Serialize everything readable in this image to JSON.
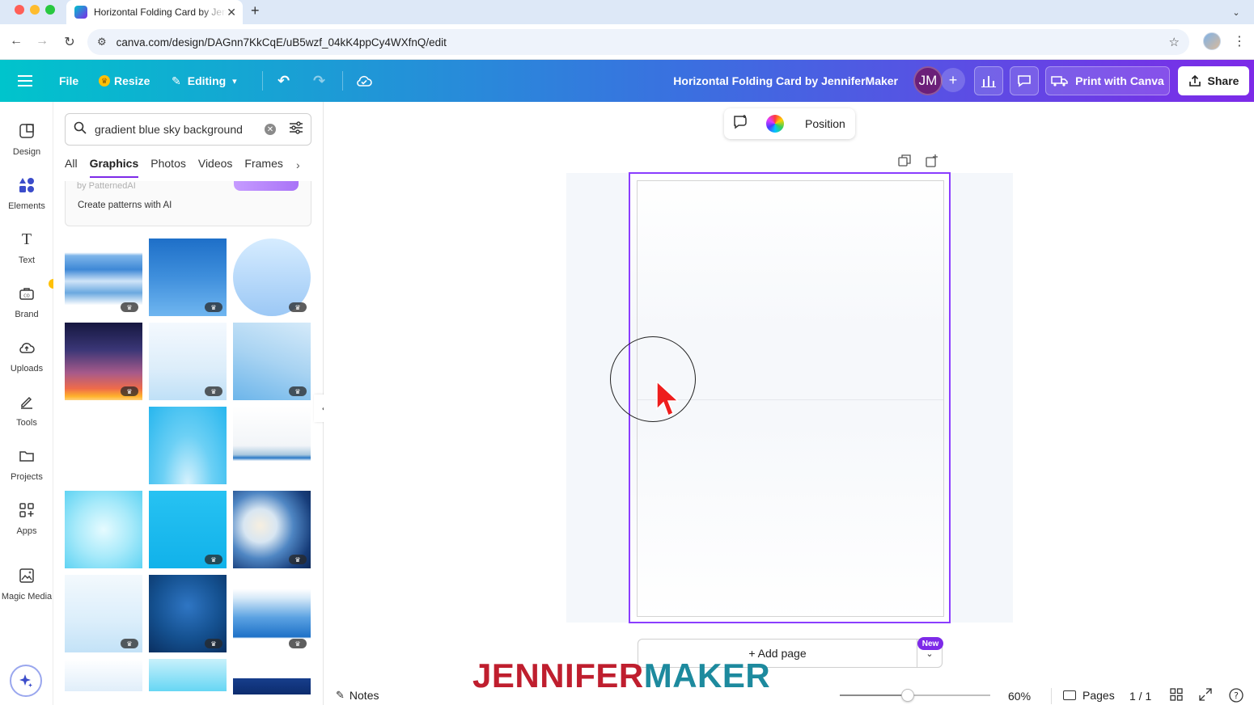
{
  "browser": {
    "tab_title": "Horizontal Folding Card by JenniferMaker",
    "tab_close": "✕",
    "new_tab": "+",
    "url": "canva.com/design/DAGnn7KkCqE/uB5wzf_04kK4ppCy4WXfnQ/edit"
  },
  "header": {
    "menu_icon": "hamburger-icon",
    "file_label": "File",
    "resize_label": "Resize",
    "editing_label": "Editing",
    "design_title": "Horizontal Folding Card by JenniferMaker",
    "avatar_initials": "JM",
    "print_label": "Print with Canva",
    "share_label": "Share"
  },
  "rail": {
    "items": [
      {
        "label": "Design",
        "icon": "design-icon"
      },
      {
        "label": "Elements",
        "icon": "elements-icon"
      },
      {
        "label": "Text",
        "icon": "text-icon"
      },
      {
        "label": "Brand",
        "icon": "brand-icon"
      },
      {
        "label": "Uploads",
        "icon": "uploads-icon"
      },
      {
        "label": "Tools",
        "icon": "tools-icon"
      },
      {
        "label": "Projects",
        "icon": "projects-icon"
      },
      {
        "label": "Apps",
        "icon": "apps-icon"
      },
      {
        "label": "Magic Media",
        "icon": "magic-media-icon"
      }
    ],
    "active": "Elements"
  },
  "panel": {
    "search_value": "gradient blue sky background",
    "tabs": [
      "All",
      "Graphics",
      "Photos",
      "Videos",
      "Frames"
    ],
    "active_tab": "Graphics",
    "pattern_sub": "by PatternedAI",
    "pattern_text": "Create patterns with AI",
    "thumbnails": [
      {
        "name": "clouds-sky",
        "pro": true
      },
      {
        "name": "blue-gradient-square",
        "pro": true
      },
      {
        "name": "light-blue-circle",
        "pro": true
      },
      {
        "name": "sunset-gradient",
        "pro": true
      },
      {
        "name": "pale-blue-gradient",
        "pro": true
      },
      {
        "name": "soft-blue-gradient",
        "pro": true
      },
      {
        "name": "empty",
        "pro": false
      },
      {
        "name": "cyan-gradient",
        "pro": false
      },
      {
        "name": "white-blue-fade",
        "pro": false
      },
      {
        "name": "aqua-haze",
        "pro": false
      },
      {
        "name": "bright-cyan",
        "pro": true
      },
      {
        "name": "watercolor-clouds",
        "pro": true
      },
      {
        "name": "white-blue-soft",
        "pro": true
      },
      {
        "name": "deep-blue-radial",
        "pro": true
      },
      {
        "name": "blue-horizon",
        "pro": true
      }
    ]
  },
  "canvas": {
    "context_position": "Position",
    "add_page": "+ Add page",
    "new_badge": "New"
  },
  "footer": {
    "notes": "Notes",
    "zoom": "60%",
    "zoom_fraction": 0.45,
    "pages_label": "Pages",
    "page_count": "1 / 1"
  },
  "watermark": {
    "part1": "JENNIFER",
    "part2": "MAKER"
  },
  "colors": {
    "accent": "#7d2ae8",
    "header_start": "#00c4cc",
    "header_end": "#7d2ae8",
    "avatar": "#6b1f79"
  }
}
